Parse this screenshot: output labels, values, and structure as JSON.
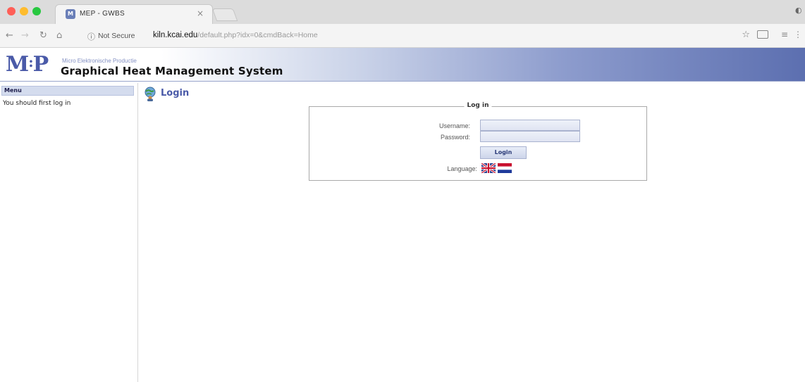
{
  "browser": {
    "tab_title": "MEP - GWBS",
    "tab_close": "×",
    "security_label": "Not Secure",
    "url_host": "kiln.kcai.edu",
    "url_path": "/default.php?idx=0&cmdBack=Home"
  },
  "header": {
    "logo_left": "M",
    "logo_mid": ":",
    "logo_right": "P",
    "subtitle": "Micro Elektronische Productie",
    "title": "Graphical Heat Management System",
    "colors": {
      "brand": "#4a5aa8",
      "gradient_end": "#5c6fb0"
    }
  },
  "sidebar": {
    "heading": "Menu",
    "message": "You should first log in"
  },
  "main": {
    "page_title": "Login",
    "login_box": {
      "legend": "Log in",
      "username_label": "Username:",
      "password_label": "Password:",
      "username_value": "",
      "password_value": "",
      "submit_label": "Login",
      "language_label": "Language:",
      "languages": [
        "en",
        "nl"
      ]
    }
  }
}
